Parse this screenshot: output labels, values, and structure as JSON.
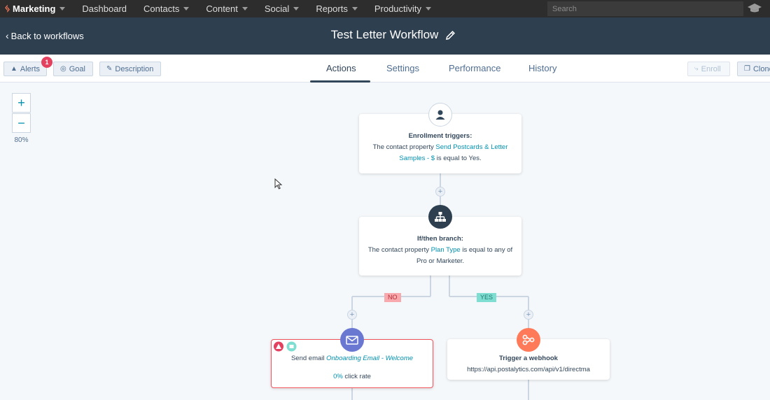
{
  "topnav": {
    "brand": "Marketing",
    "items": [
      "Dashboard",
      "Contacts",
      "Content",
      "Social",
      "Reports",
      "Productivity"
    ],
    "search_placeholder": "Search"
  },
  "header": {
    "back_label": "Back to workflows",
    "title": "Test Letter Workflow"
  },
  "toolbar": {
    "alerts_label": "Alerts",
    "alerts_count": "1",
    "goal_label": "Goal",
    "description_label": "Description",
    "tabs": [
      "Actions",
      "Settings",
      "Performance",
      "History"
    ],
    "active_tab": "Actions",
    "enroll_label": "Enroll",
    "clone_label": "Clone"
  },
  "zoom": {
    "plus": "+",
    "minus": "−",
    "level": "80%"
  },
  "workflow": {
    "trigger": {
      "title": "Enrollment triggers:",
      "text_before": "The contact property ",
      "property": "Send Postcards & Letter Samples - $",
      "text_after": " is equal to Yes."
    },
    "branch": {
      "title": "If/then branch:",
      "text_before": "The contact property ",
      "property": "Plan Type",
      "text_after": " is equal to any of Pro or Marketer.",
      "no_label": "NO",
      "yes_label": "YES"
    },
    "email_action": {
      "text_before": "Send email ",
      "email_name": "Onboarding Email - Welcome",
      "rate_value": "0%",
      "rate_label": " click rate"
    },
    "webhook_action": {
      "title": "Trigger a webhook",
      "url": "https://api.postalytics.com/api/v1/directma"
    }
  },
  "colors": {
    "nav_bg": "#2d2d2d",
    "header_bg": "#2e3f50",
    "link": "#0091ae",
    "branch_icon": "#2e3f50",
    "email_icon": "#6a78d1",
    "webhook_icon": "#ff7a59",
    "error": "#f2545b"
  }
}
